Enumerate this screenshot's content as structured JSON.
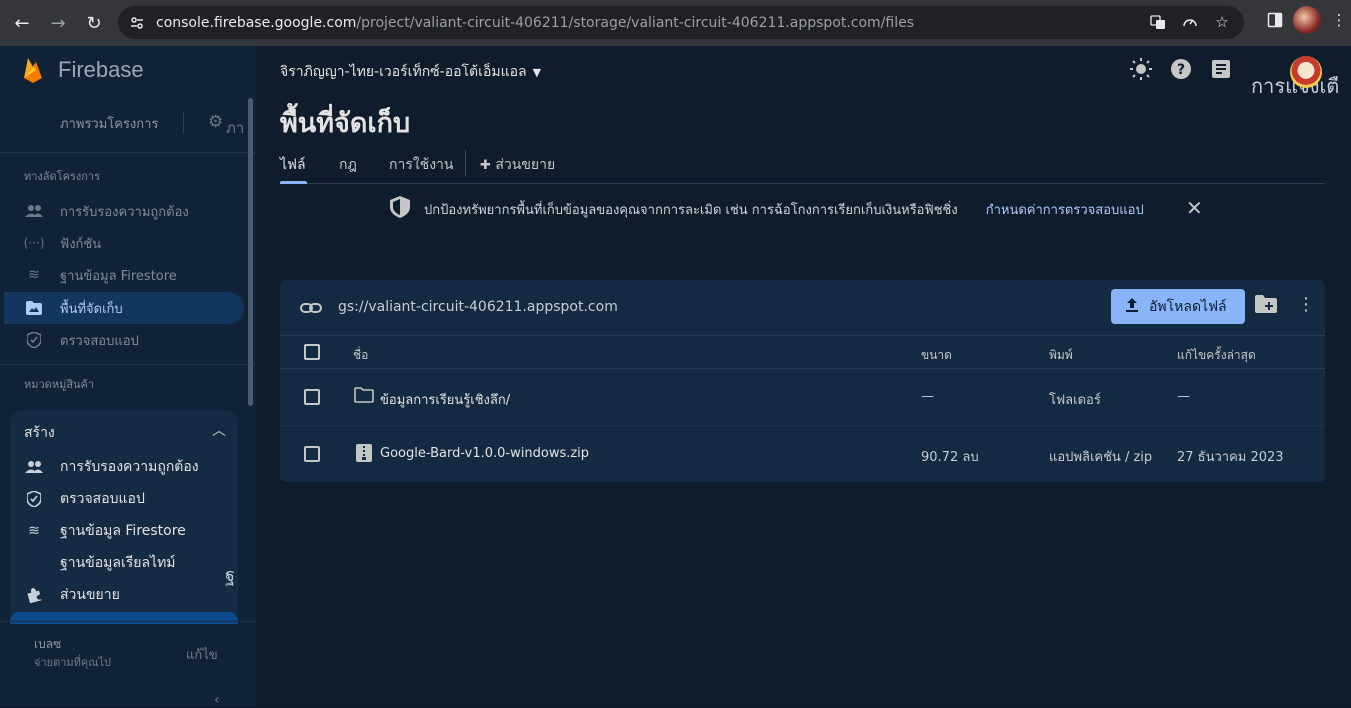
{
  "browser": {
    "url_host": "console.firebase.google.com",
    "url_path": "/project/valiant-circuit-406211/storage/valiant-circuit-406211.appspot.com/files"
  },
  "sidebar": {
    "brand": "Firebase",
    "overview": "ภาพรวมโครงการ",
    "settings_text": "ภา",
    "shortcuts_label": "ทางลัดโครงการ",
    "shortcuts": [
      {
        "label": "การรับรองความถูกต้อง",
        "icon": "people-icon"
      },
      {
        "label": "ฟังก์ชัน",
        "icon": "functions-icon"
      },
      {
        "label": "ฐานข้อมูล Firestore",
        "icon": "firestore-icon"
      },
      {
        "label": "พื้นที่จัดเก็บ",
        "icon": "storage-icon"
      },
      {
        "label": "ตรวจสอบแอป",
        "icon": "app-check-icon"
      }
    ],
    "categories_label": "หมวดหมู่สินค้า",
    "build": {
      "title": "สร้าง",
      "items": [
        {
          "label": "การรับรองความถูกต้อง",
          "icon": "people-icon"
        },
        {
          "label": "ตรวจสอบแอป",
          "icon": "app-check-icon"
        },
        {
          "label": "ฐานข้อมูล Firestore",
          "icon": "firestore-icon"
        },
        {
          "label": "ฐานข้อมูลเรียลไทม์",
          "icon": ""
        },
        {
          "label": "ส่วนขยาย",
          "icon": "extensions-icon"
        }
      ]
    },
    "stray_char": "ฐ",
    "plan": {
      "name": "เบลซ",
      "desc": "จ่ายตามที่คุณไป",
      "modify": "แก้ไข"
    }
  },
  "header": {
    "project": "จิราภิญญา-ไทย-เวอร์เท็กซ์-ออโต้เอ็มแอล",
    "avatar_text": "การแจ้งเตื"
  },
  "page": {
    "title": "พื้นที่จัดเก็บ",
    "tabs": [
      "ไฟล์",
      "กฎ",
      "การใช้งาน",
      "ส่วนขยาย"
    ]
  },
  "banner": {
    "text": "ปกป้องทรัพยากรพื้นที่เก็บข้อมูลของคุณจากการละเมิด เช่น การฉ้อโกงการเรียกเก็บเงินหรือฟิชชิ่ง",
    "link": "กำหนดค่าการตรวจสอบแอป"
  },
  "files": {
    "bucket": "gs://valiant-circuit-406211.appspot.com",
    "upload_label": "อัพโหลดไฟล์",
    "columns": {
      "name": "ชื่อ",
      "size": "ขนาด",
      "type": "พิมพ์",
      "modified": "แก้ไขครั้งล่าสุด"
    },
    "rows": [
      {
        "name": "ข้อมูลการเรียนรู้เชิงลึก/",
        "size": "—",
        "type": "โฟลเดอร์",
        "modified": "—",
        "icon": "folder-icon"
      },
      {
        "name": "Google-Bard-v1.0.0-windows.zip",
        "size": "90.72 ลบ",
        "type": "แอปพลิเคชัน / zip",
        "modified": "27 ธันวาคม 2023",
        "icon": "zip-file-icon"
      }
    ]
  }
}
